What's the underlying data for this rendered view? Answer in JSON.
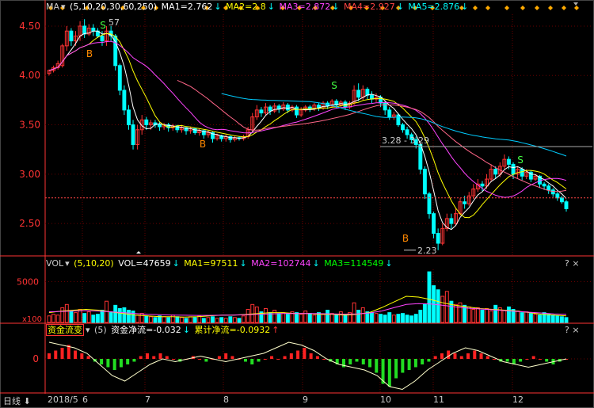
{
  "colors": {
    "up": "#ff3333",
    "down": "#00ffff",
    "ma1": "#ffffff",
    "ma2": "#ffff00",
    "ma3": "#ff44ff",
    "ma4": "#ff8800",
    "ma5": "#00ff88",
    "vol_ma1": "#ffff00",
    "vol_ma2": "#ff44ff",
    "vol_ma3": "#00ff00",
    "flow": "#ffffcc",
    "grid": "#660000",
    "axis": "#ff3333",
    "dot": "#ffaa00",
    "buy": "#ff8800",
    "sell": "#44ff44"
  },
  "main_header": {
    "indicator": "MA",
    "params": "(5,10,20,30,60,250)",
    "ma1": "MA1=2.762",
    "ma2": "MA2=2.8",
    "ma3": "MA3=2.872",
    "ma4": "MA4=2.927",
    "ma5": "MA5=2.876"
  },
  "vol_header": {
    "indicator": "VOL",
    "params": "(5,10,20)",
    "vol": "VOL=47659",
    "ma1": "MA1=97511",
    "ma2": "MA2=102744",
    "ma3": "MA3=114549"
  },
  "flow_header": {
    "indicator": "资金流变",
    "params": "(5)",
    "net": "资金净流=-0.032",
    "cum": "累计净流=-0.0932"
  },
  "qmarks": "? ×",
  "bottom": {
    "period": "日线",
    "months": [
      "2018/5",
      "6",
      "7",
      "8",
      "9",
      "10",
      "11",
      "12"
    ]
  },
  "chart_data": [
    {
      "type": "candlestick",
      "title": "",
      "y_ticks": [
        4.5,
        4.0,
        3.5,
        3.0,
        2.5
      ],
      "ylim": [
        2.18,
        4.62
      ],
      "annotations": [
        "57",
        "3.28 - 3.29",
        "2.23"
      ],
      "signals": [
        "B",
        "S",
        "B",
        "S",
        "B",
        "S"
      ],
      "candles": [
        [
          4.02,
          4.05,
          4.0,
          4.06
        ],
        [
          4.05,
          4.08,
          4.03,
          4.1
        ],
        [
          4.08,
          4.12,
          4.06,
          4.15
        ],
        [
          4.1,
          4.3,
          4.08,
          4.32
        ],
        [
          4.3,
          4.45,
          4.25,
          4.5
        ],
        [
          4.45,
          4.35,
          4.3,
          4.48
        ],
        [
          4.35,
          4.4,
          4.3,
          4.45
        ],
        [
          4.4,
          4.5,
          4.35,
          4.55
        ],
        [
          4.5,
          4.42,
          4.38,
          4.57
        ],
        [
          4.42,
          4.48,
          4.4,
          4.52
        ],
        [
          4.48,
          4.45,
          4.4,
          4.52
        ],
        [
          4.45,
          4.4,
          4.38,
          4.48
        ],
        [
          4.4,
          4.35,
          4.3,
          4.45
        ],
        [
          4.35,
          4.45,
          4.3,
          4.5
        ],
        [
          4.45,
          4.4,
          4.35,
          4.5
        ],
        [
          4.4,
          4.1,
          4.05,
          4.42
        ],
        [
          4.1,
          3.85,
          3.8,
          4.12
        ],
        [
          3.85,
          3.65,
          3.6,
          3.9
        ],
        [
          3.65,
          3.5,
          3.45,
          3.7
        ],
        [
          3.5,
          3.3,
          3.25,
          3.55
        ],
        [
          3.3,
          3.45,
          3.25,
          3.5
        ],
        [
          3.45,
          3.55,
          3.4,
          3.6
        ],
        [
          3.55,
          3.5,
          3.45,
          3.58
        ],
        [
          3.5,
          3.52,
          3.45,
          3.55
        ],
        [
          3.52,
          3.5,
          3.47,
          3.55
        ],
        [
          3.5,
          3.48,
          3.44,
          3.53
        ],
        [
          3.48,
          3.5,
          3.45,
          3.52
        ],
        [
          3.5,
          3.47,
          3.43,
          3.52
        ],
        [
          3.47,
          3.49,
          3.44,
          3.51
        ],
        [
          3.49,
          3.45,
          3.42,
          3.5
        ],
        [
          3.45,
          3.47,
          3.42,
          3.49
        ],
        [
          3.47,
          3.44,
          3.4,
          3.48
        ],
        [
          3.44,
          3.46,
          3.41,
          3.48
        ],
        [
          3.46,
          3.42,
          3.4,
          3.47
        ],
        [
          3.42,
          3.44,
          3.39,
          3.46
        ],
        [
          3.44,
          3.4,
          3.36,
          3.45
        ],
        [
          3.4,
          3.42,
          3.37,
          3.44
        ],
        [
          3.42,
          3.36,
          3.32,
          3.43
        ],
        [
          3.36,
          3.39,
          3.34,
          3.41
        ],
        [
          3.39,
          3.36,
          3.33,
          3.4
        ],
        [
          3.36,
          3.38,
          3.33,
          3.4
        ],
        [
          3.38,
          3.35,
          3.32,
          3.39
        ],
        [
          3.35,
          3.37,
          3.33,
          3.39
        ],
        [
          3.37,
          3.36,
          3.34,
          3.38
        ],
        [
          3.36,
          3.38,
          3.34,
          3.4
        ],
        [
          3.38,
          3.45,
          3.36,
          3.48
        ],
        [
          3.45,
          3.58,
          3.43,
          3.62
        ],
        [
          3.58,
          3.65,
          3.55,
          3.7
        ],
        [
          3.65,
          3.62,
          3.58,
          3.68
        ],
        [
          3.62,
          3.68,
          3.6,
          3.72
        ],
        [
          3.68,
          3.64,
          3.6,
          3.7
        ],
        [
          3.64,
          3.69,
          3.62,
          3.72
        ],
        [
          3.69,
          3.66,
          3.62,
          3.71
        ],
        [
          3.66,
          3.7,
          3.64,
          3.73
        ],
        [
          3.7,
          3.65,
          3.62,
          3.72
        ],
        [
          3.65,
          3.68,
          3.63,
          3.7
        ],
        [
          3.68,
          3.6,
          3.57,
          3.7
        ],
        [
          3.6,
          3.65,
          3.58,
          3.68
        ],
        [
          3.65,
          3.68,
          3.63,
          3.7
        ],
        [
          3.68,
          3.66,
          3.63,
          3.7
        ],
        [
          3.66,
          3.7,
          3.64,
          3.72
        ],
        [
          3.7,
          3.67,
          3.64,
          3.72
        ],
        [
          3.67,
          3.72,
          3.65,
          3.74
        ],
        [
          3.72,
          3.69,
          3.66,
          3.74
        ],
        [
          3.69,
          3.74,
          3.67,
          3.76
        ],
        [
          3.74,
          3.7,
          3.67,
          3.76
        ],
        [
          3.7,
          3.73,
          3.68,
          3.75
        ],
        [
          3.73,
          3.68,
          3.65,
          3.75
        ],
        [
          3.68,
          3.72,
          3.66,
          3.74
        ],
        [
          3.72,
          3.85,
          3.7,
          3.9
        ],
        [
          3.85,
          3.78,
          3.74,
          3.92
        ],
        [
          3.78,
          3.86,
          3.75,
          3.9
        ],
        [
          3.86,
          3.8,
          3.76,
          3.88
        ],
        [
          3.8,
          3.76,
          3.72,
          3.84
        ],
        [
          3.76,
          3.78,
          3.73,
          3.82
        ],
        [
          3.78,
          3.72,
          3.68,
          3.8
        ],
        [
          3.72,
          3.65,
          3.6,
          3.74
        ],
        [
          3.65,
          3.58,
          3.55,
          3.68
        ],
        [
          3.58,
          3.6,
          3.55,
          3.63
        ],
        [
          3.6,
          3.5,
          3.48,
          3.62
        ],
        [
          3.5,
          3.45,
          3.42,
          3.52
        ],
        [
          3.45,
          3.4,
          3.36,
          3.48
        ],
        [
          3.4,
          3.35,
          3.32,
          3.42
        ],
        [
          3.35,
          3.3,
          3.26,
          3.38
        ],
        [
          3.3,
          3.05,
          3.0,
          3.32
        ],
        [
          3.05,
          2.8,
          2.75,
          3.08
        ],
        [
          2.8,
          2.6,
          2.55,
          2.82
        ],
        [
          2.6,
          2.4,
          2.35,
          2.62
        ],
        [
          2.4,
          2.3,
          2.23,
          2.45
        ],
        [
          2.3,
          2.45,
          2.28,
          2.5
        ],
        [
          2.45,
          2.55,
          2.42,
          2.6
        ],
        [
          2.55,
          2.5,
          2.45,
          2.6
        ],
        [
          2.5,
          2.6,
          2.48,
          2.65
        ],
        [
          2.6,
          2.72,
          2.58,
          2.76
        ],
        [
          2.72,
          2.7,
          2.65,
          2.78
        ],
        [
          2.7,
          2.78,
          2.68,
          2.82
        ],
        [
          2.78,
          2.85,
          2.75,
          2.9
        ],
        [
          2.85,
          2.9,
          2.82,
          2.95
        ],
        [
          2.9,
          2.88,
          2.83,
          2.93
        ],
        [
          2.88,
          2.95,
          2.85,
          3.0
        ],
        [
          2.95,
          3.05,
          2.92,
          3.1
        ],
        [
          3.05,
          3.0,
          2.95,
          3.08
        ],
        [
          3.0,
          3.08,
          2.97,
          3.12
        ],
        [
          3.08,
          3.15,
          3.05,
          3.2
        ],
        [
          3.15,
          3.1,
          3.05,
          3.18
        ],
        [
          3.1,
          3.0,
          2.95,
          3.12
        ],
        [
          3.0,
          3.05,
          2.96,
          3.08
        ],
        [
          3.05,
          2.98,
          2.94,
          3.07
        ],
        [
          2.98,
          3.02,
          2.95,
          3.05
        ],
        [
          3.02,
          2.95,
          2.92,
          3.04
        ],
        [
          2.95,
          2.98,
          2.93,
          3.0
        ],
        [
          2.98,
          2.9,
          2.86,
          2.99
        ],
        [
          2.9,
          2.88,
          2.84,
          2.92
        ],
        [
          2.88,
          2.84,
          2.8,
          2.9
        ],
        [
          2.84,
          2.8,
          2.77,
          2.86
        ],
        [
          2.8,
          2.76,
          2.73,
          2.82
        ],
        [
          2.76,
          2.72,
          2.7,
          2.78
        ],
        [
          2.72,
          2.65,
          2.62,
          2.74
        ]
      ],
      "lines": {
        "ma5": [
          3.84,
          3.8,
          3.76,
          3.72,
          3.7,
          3.68,
          3.66,
          3.64,
          3.62,
          3.6,
          3.58,
          3.56,
          3.54,
          3.52,
          3.5,
          3.48,
          3.46,
          3.45,
          3.44,
          3.42,
          3.41,
          3.4,
          3.39,
          3.38,
          3.37,
          3.36,
          3.35,
          3.35,
          3.34,
          3.34
        ],
        "ma60_flat": 3.28
      }
    },
    {
      "type": "bar",
      "title": "",
      "y_ticks": [
        5000,
        0
      ],
      "ylim": [
        0,
        6500
      ],
      "y_unit": "x100",
      "values": [
        800,
        1000,
        900,
        1800,
        2200,
        1400,
        1200,
        1600,
        1100,
        1300,
        900,
        1000,
        1500,
        2600,
        1300,
        2100,
        1700,
        1800,
        1500,
        1400,
        900,
        1100,
        800,
        700,
        600,
        800,
        700,
        600,
        900,
        700,
        600,
        500,
        700,
        600,
        800,
        500,
        600,
        700,
        500,
        600,
        500,
        700,
        600,
        500,
        800,
        1600,
        2200,
        1900,
        1300,
        1700,
        1200,
        1500,
        1100,
        1200,
        1000,
        1300,
        1200,
        1000,
        1400,
        1100,
        900,
        1200,
        1000,
        1500,
        1100,
        900,
        1300,
        1000,
        1200,
        2400,
        1500,
        1800,
        1300,
        1200,
        1100,
        1000,
        900,
        1200,
        900,
        1000,
        1100,
        900,
        800,
        1000,
        1500,
        2200,
        6200,
        4500,
        4000,
        3200,
        3800,
        2600,
        2200,
        2400,
        2100,
        1900,
        1600,
        1800,
        1500,
        1700,
        1400,
        2100,
        1800,
        1500,
        1900,
        1600,
        1400,
        1200,
        1300,
        1100,
        1000,
        900,
        1200,
        1000,
        900,
        800,
        700,
        600
      ],
      "ma_lines": [
        {
          "values": [
            1200,
            1400,
            1500,
            1600,
            1500,
            1300,
            1100,
            900,
            800,
            700,
            700,
            650,
            700,
            800,
            900,
            900,
            1000,
            1100,
            1200,
            1200,
            1100,
            1100,
            1000,
            1000,
            900,
            1000,
            1200,
            1800,
            2500,
            3200,
            3100,
            2800,
            2400,
            2100,
            1900,
            1700,
            1600,
            1500,
            1400,
            1200,
            1000,
            900,
            800
          ]
        },
        {
          "values": [
            1300,
            1350,
            1400,
            1450,
            1400,
            1300,
            1200,
            1100,
            1000,
            950,
            900,
            880,
            860,
            860,
            880,
            900,
            950,
            1000,
            1050,
            1100,
            1100,
            1100,
            1080,
            1050,
            1020,
            1050,
            1150,
            1400,
            1800,
            2200,
            2300,
            2250,
            2100,
            1900,
            1750,
            1650,
            1550,
            1450,
            1350,
            1250,
            1150,
            1050,
            1000
          ]
        }
      ]
    },
    {
      "type": "bar",
      "title": "",
      "y_ticks": [
        0
      ],
      "ylim": [
        -0.12,
        0.08
      ],
      "values": [
        0.02,
        0.03,
        0.04,
        0.05,
        0.03,
        0.02,
        0.01,
        -0.01,
        -0.02,
        -0.03,
        -0.04,
        -0.03,
        -0.02,
        -0.01,
        0.01,
        0.02,
        0.01,
        0.02,
        0.01,
        0.0,
        -0.01,
        0.0,
        0.01,
        0.0,
        -0.01,
        0.0,
        0.01,
        0.02,
        0.01,
        0.0,
        -0.01,
        -0.02,
        -0.01,
        0.0,
        0.01,
        0.0,
        0.01,
        0.02,
        0.03,
        0.04,
        0.02,
        0.01,
        0.0,
        -0.01,
        -0.02,
        -0.03,
        -0.02,
        -0.01,
        -0.02,
        -0.03,
        -0.05,
        -0.09,
        -0.1,
        -0.07,
        -0.05,
        -0.04,
        -0.03,
        -0.02,
        -0.01,
        0.01,
        0.02,
        0.03,
        0.02,
        0.01,
        0.02,
        0.03,
        0.02,
        0.01,
        0.0,
        -0.01,
        -0.01,
        -0.02,
        -0.01,
        0.0,
        0.01,
        0.0,
        -0.01,
        -0.02,
        -0.01,
        0.0
      ],
      "ma_lines": [
        {
          "values": [
            0.06,
            0.05,
            0.04,
            0.02,
            -0.02,
            -0.06,
            -0.08,
            -0.05,
            -0.02,
            0.0,
            -0.01,
            0.0,
            0.01,
            0.0,
            -0.01,
            0.0,
            0.01,
            0.02,
            0.04,
            0.06,
            0.05,
            0.03,
            0.0,
            -0.02,
            -0.03,
            -0.04,
            -0.06,
            -0.1,
            -0.11,
            -0.08,
            -0.04,
            -0.01,
            0.02,
            0.04,
            0.03,
            0.01,
            -0.01,
            -0.02,
            -0.03,
            -0.02,
            -0.01,
            0.0
          ]
        }
      ]
    }
  ]
}
